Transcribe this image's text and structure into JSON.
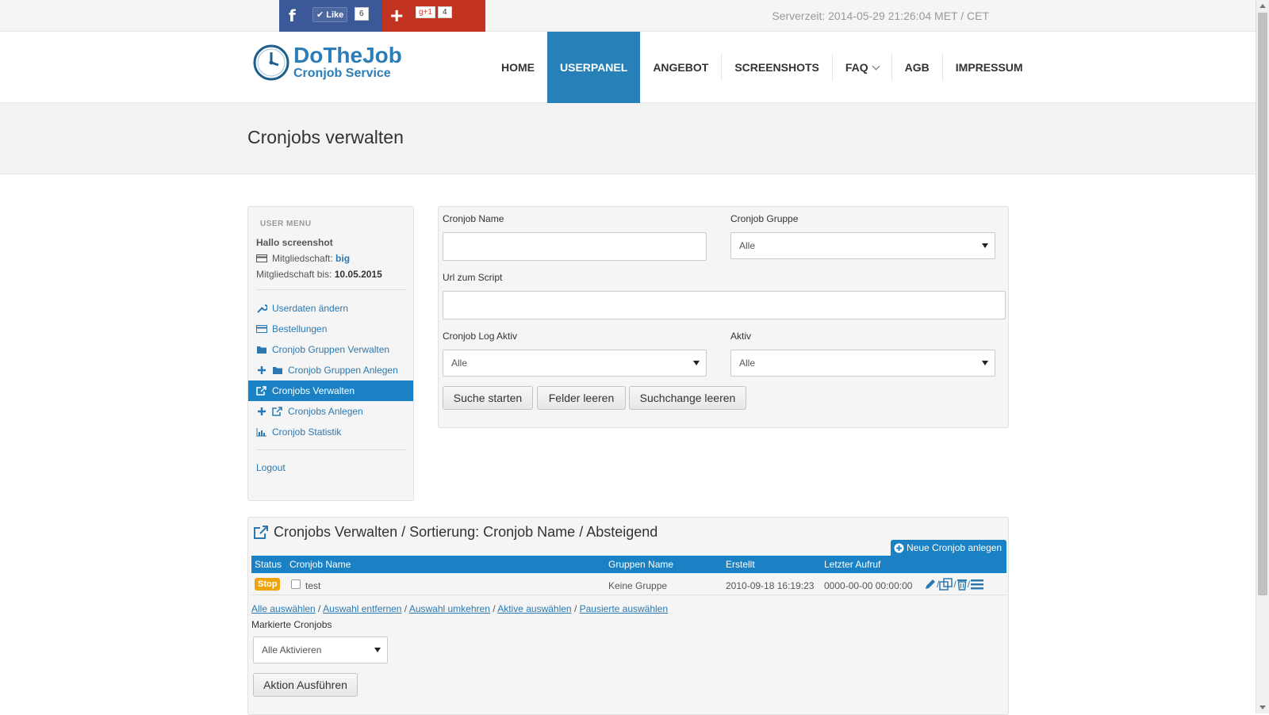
{
  "social": {
    "fb_letter": "f",
    "fb_like": "Like",
    "fb_count": "6",
    "gp_plus": "+",
    "gp_label": "g+1",
    "gp_count": "4"
  },
  "server_time": "Serverzeit: 2014-05-29 21:26:04 MET / CET",
  "logo": {
    "title": "DoTheJob",
    "subtitle": "Cronjob Service"
  },
  "nav": [
    {
      "label": "HOME"
    },
    {
      "label": "USERPANEL"
    },
    {
      "label": "ANGEBOT"
    },
    {
      "label": "SCREENSHOTS"
    },
    {
      "label": "FAQ"
    },
    {
      "label": "AGB"
    },
    {
      "label": "IMPRESSUM"
    }
  ],
  "page_title": "Cronjobs verwalten",
  "sidebar": {
    "heading": "USER MENU",
    "hello": "Hallo screenshot",
    "membership_label": "Mitgliedschaft:",
    "membership_value": "big",
    "until_label": "Mitgliedschaft bis:",
    "until_value": "10.05.2015",
    "items": [
      {
        "label": "Userdaten ändern"
      },
      {
        "label": "Bestellungen"
      },
      {
        "label": "Cronjob Gruppen Verwalten"
      },
      {
        "label": "Cronjob Gruppen Anlegen"
      },
      {
        "label": "Cronjobs Verwalten"
      },
      {
        "label": "Cronjobs Anlegen"
      },
      {
        "label": "Cronjob Statistik"
      }
    ],
    "logout": "Logout"
  },
  "search": {
    "name_label": "Cronjob Name",
    "name_value": "",
    "group_label": "Cronjob Gruppe",
    "group_value": "Alle",
    "url_label": "Url zum Script",
    "url_value": "",
    "log_label": "Cronjob Log Aktiv",
    "log_value": "Alle",
    "active_label": "Aktiv",
    "active_value": "Alle",
    "btn_search": "Suche starten",
    "btn_clear": "Felder leeren",
    "btn_clear_search": "Suchchange leeren"
  },
  "cronjobs": {
    "title": "Cronjobs Verwalten / Sortierung: Cronjob Name / Absteigend",
    "new_button": "Neue Cronjob anlegen",
    "columns": [
      "Status",
      "Cronjob Name",
      "Gruppen Name",
      "Erstellt",
      "Letzter Aufruf"
    ],
    "rows": [
      {
        "status": "Stop",
        "name": "test",
        "group": "Keine Gruppe",
        "created": "2010-09-18 16:19:23",
        "last_call": "0000-00-00 00:00:00"
      }
    ],
    "select_links": [
      "Alle auswählen",
      "Auswahl entfernen",
      "Auswahl umkehren",
      "Aktive auswählen",
      "Pausierte auswählen"
    ],
    "link_sep": " / ",
    "marked_label": "Markierte Cronjobs",
    "marked_select": "Alle Aktivieren",
    "action_button": "Aktion Ausführen"
  },
  "colors": {
    "primary": "#1a82c4",
    "nav_active": "#2880b9",
    "stop_badge": "#f0a30a",
    "facebook": "#3b5998",
    "googleplus": "#c23321"
  }
}
